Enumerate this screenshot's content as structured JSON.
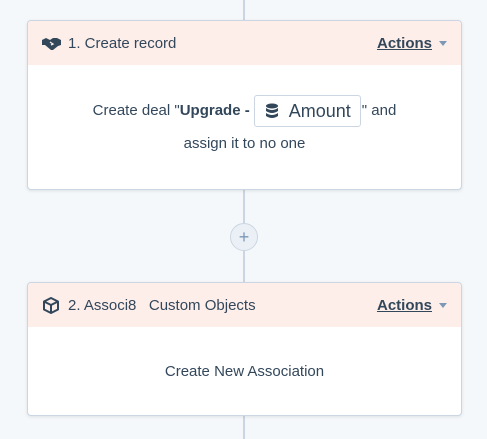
{
  "colors": {
    "header_bg": "#fdeeea",
    "canvas_bg": "#f5f8fa",
    "connector": "#cbd6e2",
    "text": "#33475b",
    "muted": "#7c98b6"
  },
  "steps": [
    {
      "title": "1. Create record",
      "icon": "handshake-icon",
      "actions_label": "Actions",
      "body": {
        "prefix": "Create deal \"",
        "bold_text": "Upgrade -",
        "token_icon": "database-icon",
        "token_label": "Amount",
        "suffix": "\" and",
        "line2": "assign it to no one"
      }
    },
    {
      "title": "2. Associ8   Custom Objects",
      "icon": "cube-icon",
      "actions_label": "Actions",
      "body": {
        "text": "Create New Association"
      }
    }
  ],
  "add_step": {
    "label": "+",
    "icon": "plus-icon"
  }
}
